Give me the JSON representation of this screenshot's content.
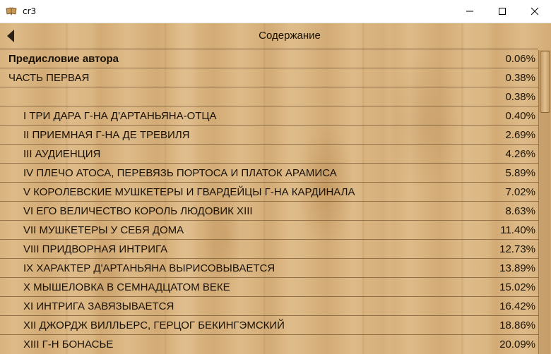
{
  "window": {
    "title": "cr3"
  },
  "header": {
    "title": "Содержание"
  },
  "toc": [
    {
      "title": "Предисловие автора",
      "percent": "0.06%"
    },
    {
      "title": "ЧАСТЬ ПЕРВАЯ",
      "percent": "0.38%"
    },
    {
      "title": "",
      "percent": "0.38%"
    },
    {
      "title": "I ТРИ ДАРА Г-НА Д'АРТАНЬЯНА-ОТЦА",
      "percent": "0.40%"
    },
    {
      "title": "II ПРИЕМНАЯ Г-НА ДЕ ТРЕВИЛЯ",
      "percent": "2.69%"
    },
    {
      "title": "III АУДИЕНЦИЯ",
      "percent": "4.26%"
    },
    {
      "title": "IV ПЛЕЧО АТОСА, ПЕРЕВЯЗЬ ПОРТОСА И ПЛАТОК АРАМИСА",
      "percent": "5.89%"
    },
    {
      "title": "V КОРОЛЕВСКИЕ МУШКЕТЕРЫ И ГВАРДЕЙЦЫ Г-НА КАРДИНАЛА",
      "percent": "7.02%"
    },
    {
      "title": "VI ЕГО ВЕЛИЧЕСТВО КОРОЛЬ ЛЮДОВИК XIII",
      "percent": "8.63%"
    },
    {
      "title": "VII МУШКЕТЕРЫ У СЕБЯ ДОМА",
      "percent": "11.40%"
    },
    {
      "title": "VIII ПРИДВОРНАЯ ИНТРИГА",
      "percent": "12.73%"
    },
    {
      "title": "IX ХАРАКТЕР Д'АРТАНЬЯНА ВЫРИСОВЫВАЕТСЯ",
      "percent": "13.89%"
    },
    {
      "title": "X МЫШЕЛОВКА В СЕМНАДЦАТОМ ВЕКЕ",
      "percent": "15.02%"
    },
    {
      "title": "XI ИНТРИГА ЗАВЯЗЫВАЕТСЯ",
      "percent": "16.42%"
    },
    {
      "title": "XII ДЖОРДЖ ВИЛЛЬЕРС, ГЕРЦОГ БЕКИНГЭМСКИЙ",
      "percent": "18.86%"
    },
    {
      "title": "XIII Г-Н БОНАСЬЕ",
      "percent": "20.09%"
    }
  ],
  "icons": {
    "app": "book-icon",
    "back": "back-arrow-icon",
    "minimize": "minimize-icon",
    "maximize": "maximize-icon",
    "close": "close-icon"
  },
  "colors": {
    "text": "#1a1206",
    "wood": "#d8b27d"
  }
}
